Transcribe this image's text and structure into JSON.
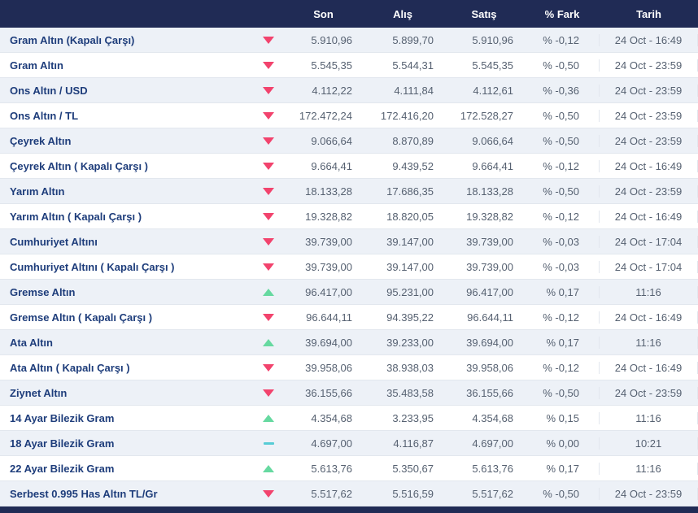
{
  "colors": {
    "header": "#202b55",
    "down": "#f2436d",
    "up": "#66d9a0",
    "flat": "#57ccd5"
  },
  "header": {
    "son": "Son",
    "alis": "Alış",
    "satis": "Satış",
    "fark": "% Fark",
    "tarih": "Tarih"
  },
  "rows": [
    {
      "name": "Gram Altın (Kapalı Çarşı)",
      "trend": "down",
      "son": "5.910,96",
      "alis": "5.899,70",
      "satis": "5.910,96",
      "fark": "% -0,12",
      "tarih": "24 Oct - 16:49"
    },
    {
      "name": "Gram Altın",
      "trend": "down",
      "son": "5.545,35",
      "alis": "5.544,31",
      "satis": "5.545,35",
      "fark": "% -0,50",
      "tarih": "24 Oct - 23:59"
    },
    {
      "name": "Ons Altın / USD",
      "trend": "down",
      "son": "4.112,22",
      "alis": "4.111,84",
      "satis": "4.112,61",
      "fark": "% -0,36",
      "tarih": "24 Oct - 23:59"
    },
    {
      "name": "Ons Altın / TL",
      "trend": "down",
      "son": "172.472,24",
      "alis": "172.416,20",
      "satis": "172.528,27",
      "fark": "% -0,50",
      "tarih": "24 Oct - 23:59"
    },
    {
      "name": "Çeyrek Altın",
      "trend": "down",
      "son": "9.066,64",
      "alis": "8.870,89",
      "satis": "9.066,64",
      "fark": "% -0,50",
      "tarih": "24 Oct - 23:59"
    },
    {
      "name": "Çeyrek Altın ( Kapalı Çarşı )",
      "trend": "down",
      "son": "9.664,41",
      "alis": "9.439,52",
      "satis": "9.664,41",
      "fark": "% -0,12",
      "tarih": "24 Oct - 16:49"
    },
    {
      "name": "Yarım Altın",
      "trend": "down",
      "son": "18.133,28",
      "alis": "17.686,35",
      "satis": "18.133,28",
      "fark": "% -0,50",
      "tarih": "24 Oct - 23:59"
    },
    {
      "name": "Yarım Altın ( Kapalı Çarşı )",
      "trend": "down",
      "son": "19.328,82",
      "alis": "18.820,05",
      "satis": "19.328,82",
      "fark": "% -0,12",
      "tarih": "24 Oct - 16:49"
    },
    {
      "name": "Cumhuriyet Altını",
      "trend": "down",
      "son": "39.739,00",
      "alis": "39.147,00",
      "satis": "39.739,00",
      "fark": "% -0,03",
      "tarih": "24 Oct - 17:04"
    },
    {
      "name": "Cumhuriyet Altını ( Kapalı Çarşı )",
      "trend": "down",
      "son": "39.739,00",
      "alis": "39.147,00",
      "satis": "39.739,00",
      "fark": "% -0,03",
      "tarih": "24 Oct - 17:04"
    },
    {
      "name": "Gremse Altın",
      "trend": "up",
      "son": "96.417,00",
      "alis": "95.231,00",
      "satis": "96.417,00",
      "fark": "% 0,17",
      "tarih": "11:16"
    },
    {
      "name": "Gremse Altın ( Kapalı Çarşı )",
      "trend": "down",
      "son": "96.644,11",
      "alis": "94.395,22",
      "satis": "96.644,11",
      "fark": "% -0,12",
      "tarih": "24 Oct - 16:49"
    },
    {
      "name": "Ata Altın",
      "trend": "up",
      "son": "39.694,00",
      "alis": "39.233,00",
      "satis": "39.694,00",
      "fark": "% 0,17",
      "tarih": "11:16"
    },
    {
      "name": "Ata Altın ( Kapalı Çarşı )",
      "trend": "down",
      "son": "39.958,06",
      "alis": "38.938,03",
      "satis": "39.958,06",
      "fark": "% -0,12",
      "tarih": "24 Oct - 16:49"
    },
    {
      "name": "Ziynet Altın",
      "trend": "down",
      "son": "36.155,66",
      "alis": "35.483,58",
      "satis": "36.155,66",
      "fark": "% -0,50",
      "tarih": "24 Oct - 23:59"
    },
    {
      "name": "14 Ayar Bilezik Gram",
      "trend": "up",
      "son": "4.354,68",
      "alis": "3.233,95",
      "satis": "4.354,68",
      "fark": "% 0,15",
      "tarih": "11:16"
    },
    {
      "name": "18 Ayar Bilezik Gram",
      "trend": "flat",
      "son": "4.697,00",
      "alis": "4.116,87",
      "satis": "4.697,00",
      "fark": "% 0,00",
      "tarih": "10:21"
    },
    {
      "name": "22 Ayar Bilezik Gram",
      "trend": "up",
      "son": "5.613,76",
      "alis": "5.350,67",
      "satis": "5.613,76",
      "fark": "% 0,17",
      "tarih": "11:16"
    },
    {
      "name": "Serbest 0.995 Has Altın TL/Gr",
      "trend": "down",
      "son": "5.517,62",
      "alis": "5.516,59",
      "satis": "5.517,62",
      "fark": "% -0,50",
      "tarih": "24 Oct - 23:59"
    }
  ]
}
